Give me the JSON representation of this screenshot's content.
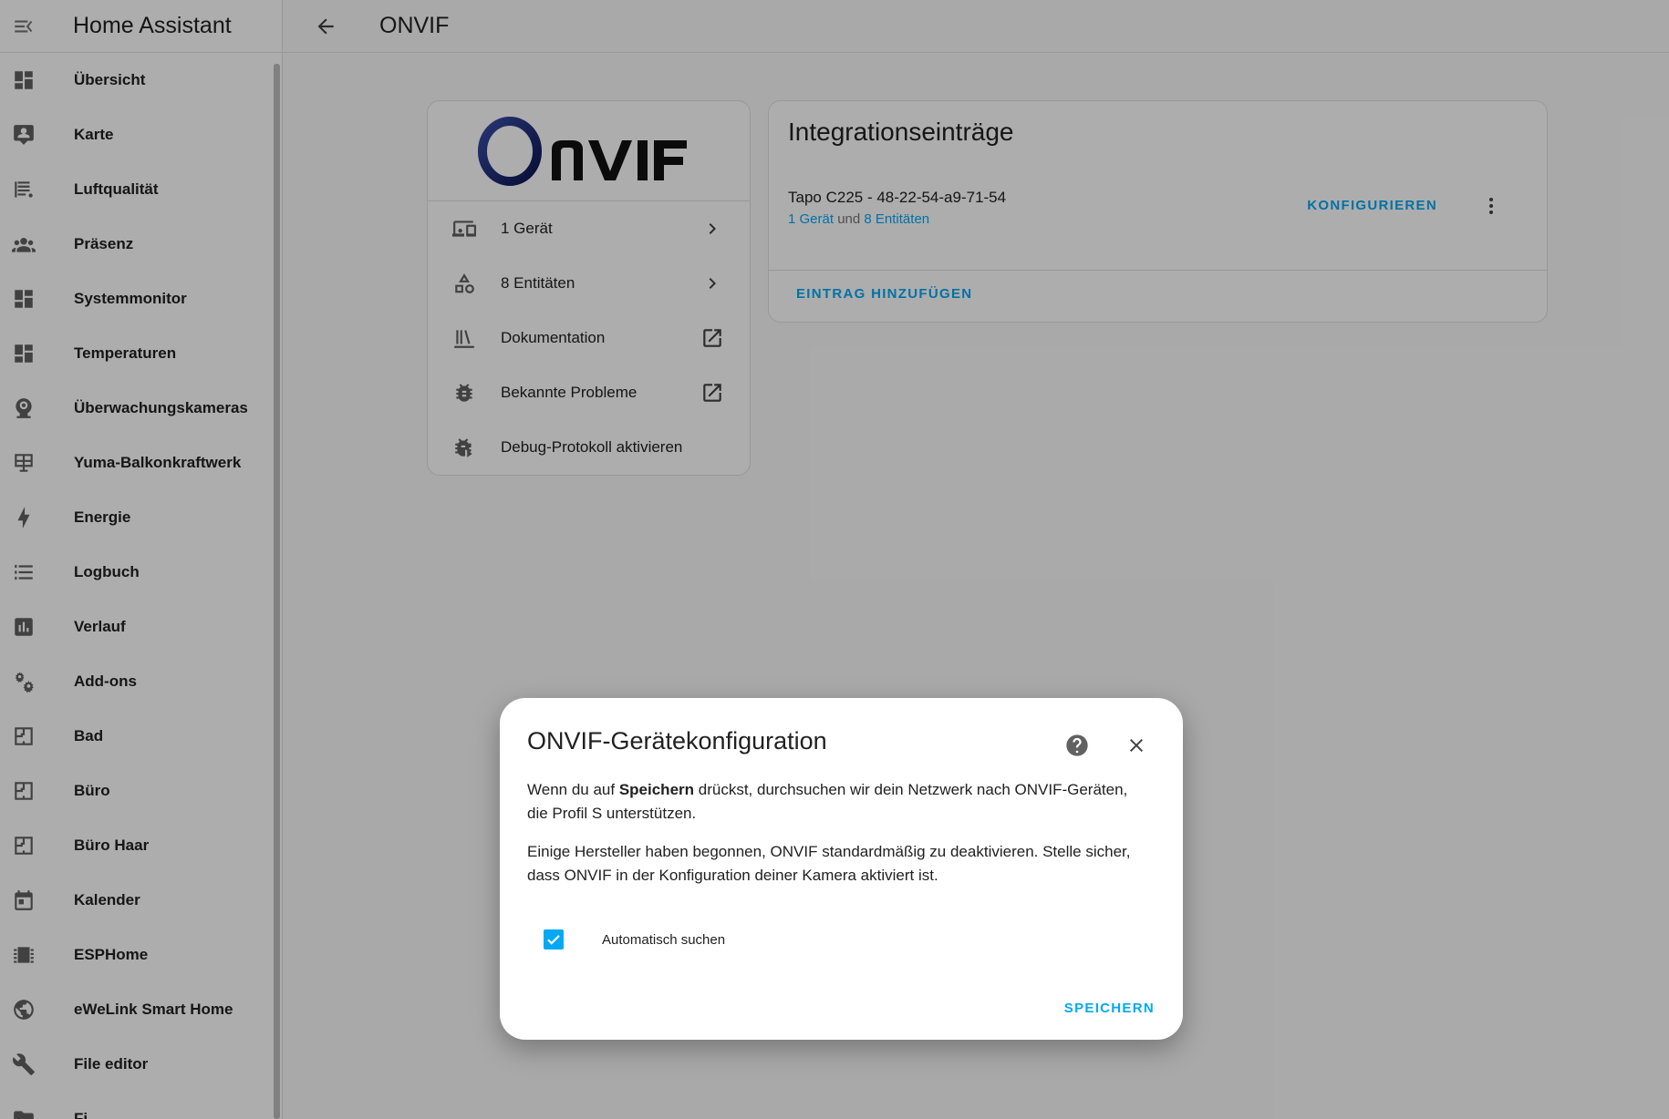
{
  "app": {
    "title": "Home Assistant"
  },
  "sidebar": {
    "items": [
      {
        "label": "Übersicht",
        "icon": "dashboard-icon"
      },
      {
        "label": "Karte",
        "icon": "map-icon"
      },
      {
        "label": "Luftqualität",
        "icon": "air-quality-icon"
      },
      {
        "label": "Präsenz",
        "icon": "people-icon"
      },
      {
        "label": "Systemmonitor",
        "icon": "dashboard-icon"
      },
      {
        "label": "Temperaturen",
        "icon": "dashboard-icon"
      },
      {
        "label": "Überwachungskameras",
        "icon": "webcam-icon"
      },
      {
        "label": "Yuma-Balkonkraftwerk",
        "icon": "solar-panel-icon"
      },
      {
        "label": "Energie",
        "icon": "lightning-bolt-icon"
      },
      {
        "label": "Logbuch",
        "icon": "list-icon"
      },
      {
        "label": "Verlauf",
        "icon": "chart-box-icon"
      },
      {
        "label": "Add-ons",
        "icon": "puzzle-cogs-icon"
      },
      {
        "label": "Bad",
        "icon": "floor-plan-icon"
      },
      {
        "label": "Büro",
        "icon": "floor-plan-icon"
      },
      {
        "label": "Büro Haar",
        "icon": "floor-plan-icon"
      },
      {
        "label": "Kalender",
        "icon": "calendar-icon"
      },
      {
        "label": "ESPHome",
        "icon": "chip-icon"
      },
      {
        "label": "eWeLink Smart Home",
        "icon": "web-icon"
      },
      {
        "label": "File editor",
        "icon": "wrench-icon"
      },
      {
        "label": "Fi",
        "icon": "folder-icon"
      }
    ]
  },
  "header": {
    "title": "ONVIF"
  },
  "integration": {
    "logo_text": "ONVIF",
    "rows": [
      {
        "label": "1 Gerät",
        "icon": "devices-icon",
        "trail": "chevron-right-icon"
      },
      {
        "label": "8 Entitäten",
        "icon": "shape-icon",
        "trail": "chevron-right-icon"
      },
      {
        "label": "Dokumentation",
        "icon": "book-icon",
        "trail": "open-in-new-icon"
      },
      {
        "label": "Bekannte Probleme",
        "icon": "bug-icon",
        "trail": "open-in-new-icon"
      },
      {
        "label": "Debug-Protokoll aktivieren",
        "icon": "bug-play-icon",
        "trail": ""
      }
    ]
  },
  "entries": {
    "title": "Integrationseinträge",
    "entry_name": "Tapo C225 - 48-22-54-a9-71-54",
    "devices_link": "1 Gerät",
    "and_text": " und ",
    "entities_link": "8 Entitäten",
    "configure_label": "KONFIGURIEREN",
    "add_label": "EINTRAG HINZUFÜGEN"
  },
  "dialog": {
    "title": "ONVIF-Gerätekonfiguration",
    "p1_prefix": "Wenn du auf ",
    "p1_bold": "Speichern",
    "p1_suffix": " drückst, durchsuchen wir dein Netzwerk nach ONVIF-Geräten, die Profil S unterstützen.",
    "p2": "Einige Hersteller haben begonnen, ONVIF standardmäßig zu deaktivieren. Stelle sicher, dass ONVIF in der Konfiguration deiner Kamera aktiviert ist.",
    "checkbox_label": "Automatisch suchen",
    "checkbox_checked": true,
    "save_label": "SPEICHERN"
  },
  "colors": {
    "accent": "#03a9f4",
    "text": "#212121",
    "icon": "#44739e"
  }
}
